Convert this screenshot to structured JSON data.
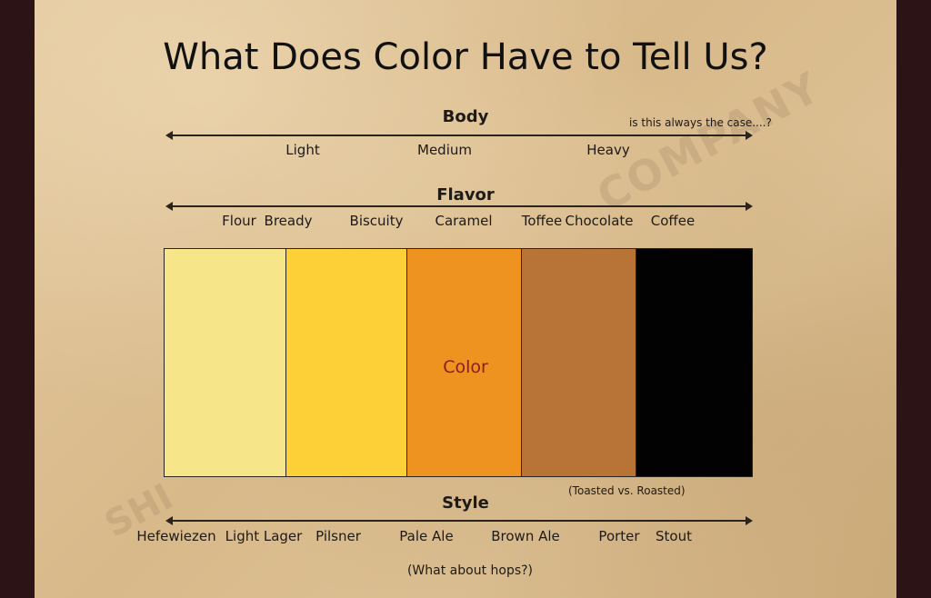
{
  "title": "What Does Color Have to Tell Us?",
  "body": {
    "heading": "Body",
    "note": "is this always the case....?",
    "levels": [
      "Light",
      "Medium",
      "Heavy"
    ]
  },
  "flavor": {
    "heading": "Flavor",
    "items": [
      "Flour",
      "Bready",
      "Biscuity",
      "Caramel",
      "Toffee",
      "Chocolate",
      "Coffee"
    ]
  },
  "color": {
    "label": "Color",
    "swatches": [
      "#f7e58a",
      "#fdd037",
      "#ef9320",
      "#b87437",
      "#030202"
    ],
    "label_color": "#8a1d1d"
  },
  "toasted_note": "(Toasted  vs. Roasted)",
  "style": {
    "heading": "Style",
    "items": [
      "Hefewiezen",
      "Light Lager",
      "Pilsner",
      "Pale Ale",
      "Brown Ale",
      "Porter",
      "Stout"
    ],
    "footnote": "(What about hops?)"
  },
  "watermark": {
    "left": "SHI",
    "right": "COMPANY"
  }
}
